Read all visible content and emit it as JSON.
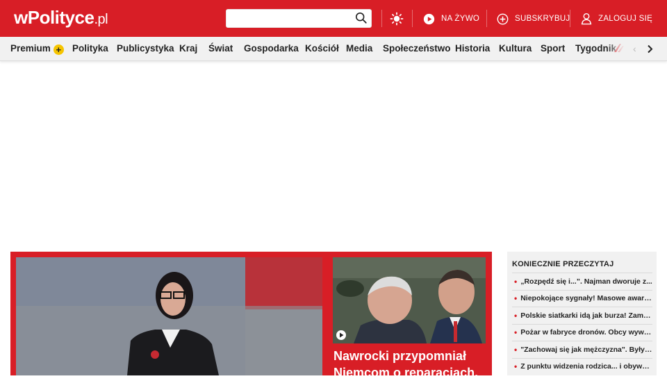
{
  "header": {
    "logo_main": "wPolityce",
    "logo_tld": ".pl",
    "search_placeholder": "",
    "live_label": "NA ŻYWO",
    "subscribe_label": "SUBSKRYBUJ",
    "login_label": "ZALOGUJ SIĘ"
  },
  "nav": {
    "items": [
      "Premium",
      "Polityka",
      "Publicystyka",
      "Kraj",
      "Świat",
      "Gospodarka",
      "Kościół",
      "Media",
      "Społeczeństwo",
      "Historia",
      "Kultura",
      "Sport",
      "Tygodnik"
    ],
    "premium_badge": "+",
    "prev_arrow": "‹",
    "next_arrow": "›"
  },
  "feature": {
    "side_title": "Nawrocki przypomniał Niemcom o reparacjach."
  },
  "sidebar": {
    "heading": "KONIECZNIE PRZECZYTAJ",
    "items": [
      "„Rozpędź się i...”. Najman dworuje z...",
      "Niepokojące sygnały! Masowe awarie...",
      "Polskie siatkarki idą jak burza! Zamiast...",
      "Pożar w fabryce dronów. Obcy wywiad...",
      "\"Zachowaj się jak mężczyzna\". Były ...",
      "Z punktu widzenia rodzica... i obywatela"
    ]
  },
  "colors": {
    "brand_red": "#d81e26",
    "premium_yellow": "#f5c400",
    "nav_bg": "#f1f1f1"
  }
}
